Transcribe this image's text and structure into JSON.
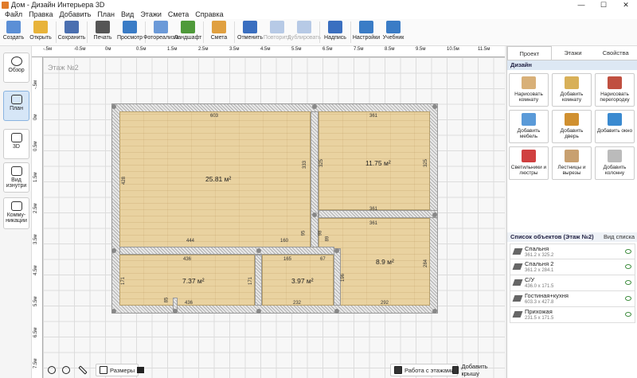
{
  "window": {
    "title": "Дом - Дизайн Интерьера 3D",
    "controls": [
      "—",
      "☐",
      "✕"
    ]
  },
  "menu": [
    "Файл",
    "Правка",
    "Добавить",
    "План",
    "Вид",
    "Этажи",
    "Смета",
    "Справка"
  ],
  "toolbar": [
    {
      "label": "Создать",
      "icon": "new-file-icon",
      "color": "#5b8fd6",
      "enabled": true
    },
    {
      "label": "Открыть",
      "icon": "open-folder-icon",
      "color": "#e8b339",
      "enabled": true
    },
    {
      "label": "Сохранить",
      "icon": "save-icon",
      "color": "#4a6fb0",
      "enabled": true
    },
    {
      "label": "Печать",
      "icon": "printer-icon",
      "color": "#555",
      "enabled": true
    },
    {
      "label": "Просмотр",
      "icon": "monitor-icon",
      "color": "#3a7cc6",
      "enabled": true
    },
    {
      "label": "Фотореализм",
      "icon": "photo-icon",
      "color": "#6b9ad8",
      "enabled": true
    },
    {
      "label": "Ландшафт",
      "icon": "tree-icon",
      "color": "#4f9a3a",
      "enabled": true
    },
    {
      "label": "Смета",
      "icon": "estimate-icon",
      "color": "#e0a040",
      "enabled": true
    },
    {
      "label": "Отменить",
      "icon": "undo-icon",
      "color": "#3a6fc0",
      "enabled": true
    },
    {
      "label": "Повторить",
      "icon": "redo-icon",
      "color": "#3a6fc0",
      "enabled": false
    },
    {
      "label": "Дублировать",
      "icon": "duplicate-icon",
      "color": "#3a6fc0",
      "enabled": false
    },
    {
      "label": "Надпись",
      "icon": "text-label-icon",
      "color": "#3a6fc0",
      "enabled": true
    },
    {
      "label": "Настройки",
      "icon": "gear-icon",
      "color": "#3a7cc6",
      "enabled": true
    },
    {
      "label": "Учебник",
      "icon": "help-icon",
      "color": "#3a7cc6",
      "enabled": true
    }
  ],
  "leftbar": [
    {
      "label": "Обзор",
      "icon": "eye-icon",
      "active": false
    },
    {
      "label": "План",
      "icon": "plan-icon",
      "active": true
    },
    {
      "label": "3D",
      "icon": "cube-icon",
      "active": false
    },
    {
      "label": "Вид изнутри",
      "icon": "inside-view-icon",
      "active": false
    },
    {
      "label": "Комму-никации",
      "icon": "communications-icon",
      "active": false
    }
  ],
  "ruler_top": [
    "-.5м",
    "-0.5м",
    "0м",
    "0.5м",
    "1.5м",
    "2.5м",
    "3.5м",
    "4.5м",
    "5.5м",
    "6.5м",
    "7.5м",
    "8.5м",
    "9.5м",
    "10.5м",
    "11.5м",
    "12.5м"
  ],
  "ruler_left": [
    "-.5м",
    "0м",
    "0.5м",
    "1.5м",
    "2.5м",
    "3.5м",
    "4.5м",
    "5.5м",
    "6.5м",
    "7.5м"
  ],
  "floor_label": "Этаж №2",
  "areas": [
    "25.81 м²",
    "11.75 м²",
    "8.9 м²",
    "7.37 м²",
    "3.97 м²"
  ],
  "dims": [
    "603",
    "361",
    "428",
    "333",
    "325",
    "325",
    "361",
    "444",
    "160",
    "95",
    "98",
    "89",
    "361",
    "284",
    "436",
    "165",
    "67",
    "171",
    "171",
    "196",
    "85",
    "436",
    "232",
    "292"
  ],
  "bottom": {
    "zoom_out": "zoom-out-icon",
    "zoom_in": "zoom-in-icon",
    "ruler": "ruler-icon",
    "sizes": "Размеры",
    "home": "home-icon",
    "floors": "Работа с этажами",
    "roof": "Добавить крышу"
  },
  "panel": {
    "tabs": [
      "Проект",
      "Этажи",
      "Свойства"
    ],
    "design_header": "Дизайн",
    "design_buttons": [
      {
        "label": "Нарисовать комнату",
        "icon": "draw-room-icon",
        "color": "#d8b078"
      },
      {
        "label": "Добавить комнату",
        "icon": "add-room-icon",
        "color": "#d8b058"
      },
      {
        "label": "Нарисовать перегородку",
        "icon": "brick-wall-icon",
        "color": "#c05040"
      },
      {
        "label": "Добавить мебель",
        "icon": "chair-icon",
        "color": "#5a9ad8"
      },
      {
        "label": "Добавить дверь",
        "icon": "door-icon",
        "color": "#d09030"
      },
      {
        "label": "Добавить окно",
        "icon": "window-icon",
        "color": "#3a8ad0"
      },
      {
        "label": "Светильники и люстры",
        "icon": "lamp-icon",
        "color": "#d04040"
      },
      {
        "label": "Лестницы и вырезы",
        "icon": "stairs-icon",
        "color": "#c8a070"
      },
      {
        "label": "Добавить колонну",
        "icon": "column-icon",
        "color": "#bbb"
      }
    ],
    "list_header": "Список объектов (Этаж №2)",
    "list_view": "Вид списка",
    "objects": [
      {
        "name": "Спальня",
        "size": "361.2 x 325.2"
      },
      {
        "name": "Спальня 2",
        "size": "361.2 x 284.1"
      },
      {
        "name": "С/У",
        "size": "436.0 x 171.5"
      },
      {
        "name": "Гостиная+кухня",
        "size": "603.3 x 427.8"
      },
      {
        "name": "Прихожая",
        "size": "231.5 x 171.5"
      }
    ]
  }
}
